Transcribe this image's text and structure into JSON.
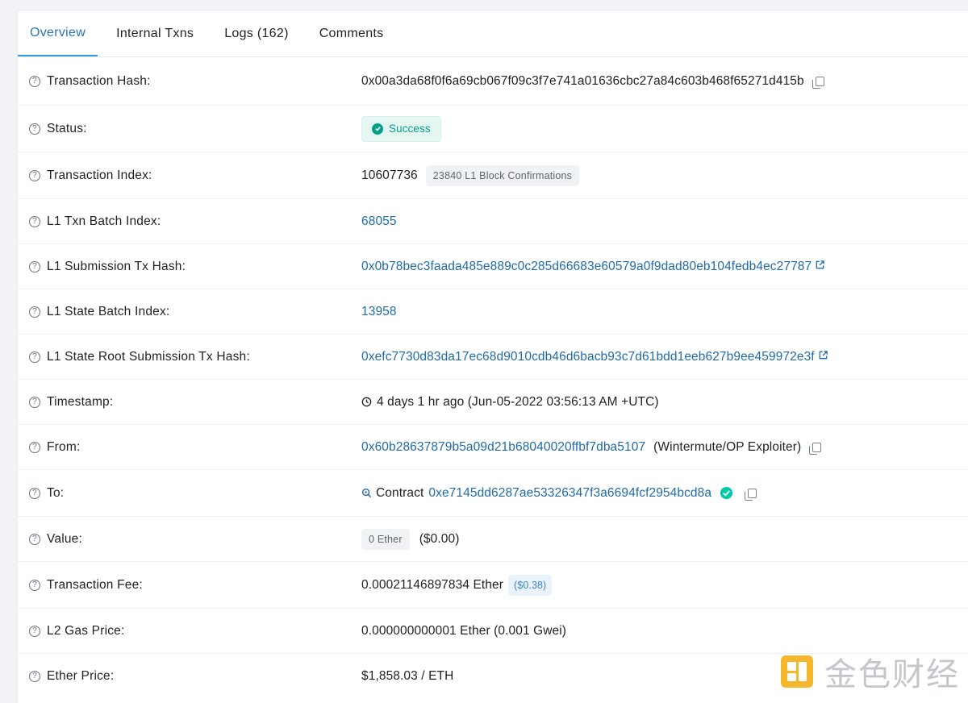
{
  "tabs": [
    {
      "label": "Overview"
    },
    {
      "label": "Internal Txns"
    },
    {
      "label": "Logs (162)"
    },
    {
      "label": "Comments"
    }
  ],
  "fields": {
    "tx_hash": {
      "label": "Transaction Hash:",
      "value": "0x00a3da68f0f6a69cb067f09c3f7e741a01636cbc27a84c603b468f65271d415b"
    },
    "status": {
      "label": "Status:",
      "value": "Success"
    },
    "tx_index": {
      "label": "Transaction Index:",
      "value": "10607736",
      "confirmations": "23840 L1 Block Confirmations"
    },
    "l1_batch_index": {
      "label": "L1 Txn Batch Index:",
      "value": "68055"
    },
    "l1_submission": {
      "label": "L1 Submission Tx Hash:",
      "value": "0x0b78bec3faada485e889c0c285d66683e60579a0f9dad80eb104fedb4ec27787"
    },
    "l1_state_batch": {
      "label": "L1 State Batch Index:",
      "value": "13958"
    },
    "l1_state_root": {
      "label": "L1 State Root Submission Tx Hash:",
      "value": "0xefc7730d83da17ec68d9010cdb46d6bacb93c7d61bdd1eeb627b9ee459972e3f"
    },
    "timestamp": {
      "label": "Timestamp:",
      "value": "4 days 1 hr ago (Jun-05-2022 03:56:13 AM +UTC)"
    },
    "from": {
      "label": "From:",
      "address": "0x60b28637879b5a09d21b68040020ffbf7dba5107",
      "name": "(Wintermute/OP Exploiter)"
    },
    "to": {
      "label": "To:",
      "prefix": "Contract",
      "address": "0xe7145dd6287ae53326347f3a6694fcf2954bcd8a"
    },
    "value": {
      "label": "Value:",
      "amount": "0 Ether",
      "usd": "($0.00)"
    },
    "fee": {
      "label": "Transaction Fee:",
      "amount": "0.00021146897834 Ether",
      "usd": "($0.38)"
    },
    "gas_price": {
      "label": "L2 Gas Price:",
      "value": "0.000000000001 Ether (0.001 Gwei)"
    },
    "ether_price": {
      "label": "Ether Price:",
      "value": "$1,858.03 / ETH"
    }
  },
  "watermark": {
    "text": "金色财经"
  },
  "colors": {
    "link": "#1f6ba8",
    "success": "#00a186",
    "accent": "#3498db"
  }
}
